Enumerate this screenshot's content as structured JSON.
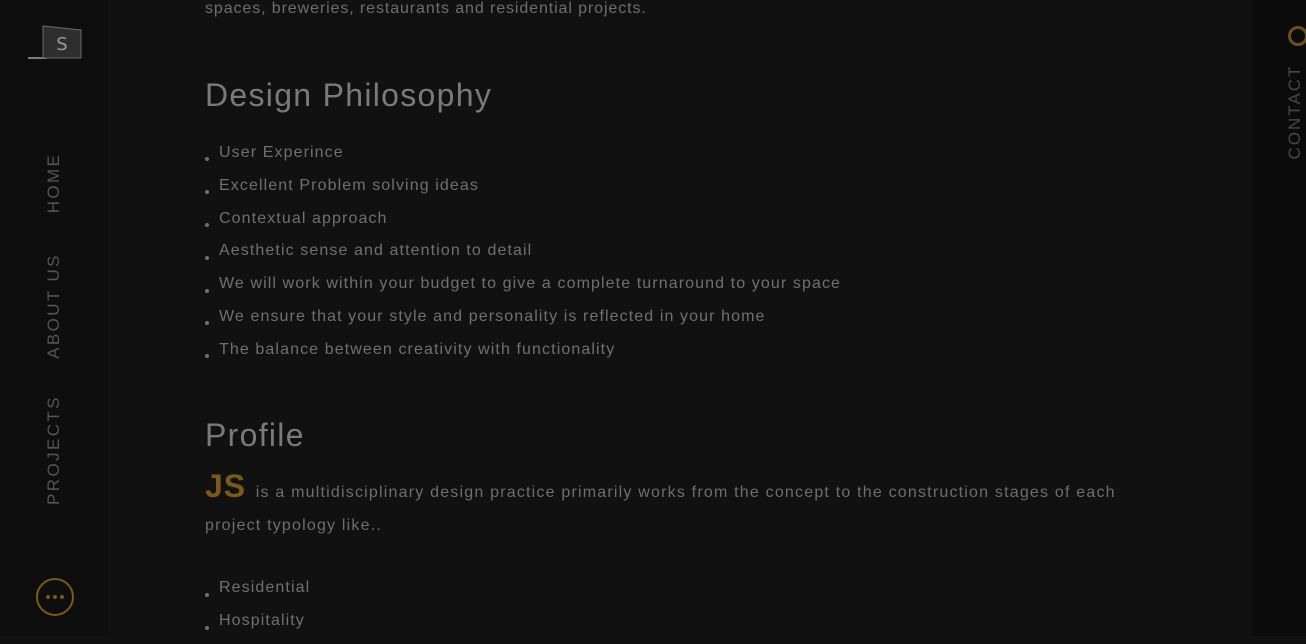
{
  "sidebar": {
    "logo_letter": "S",
    "nav": [
      {
        "label": "HOME"
      },
      {
        "label": "ABOUT US"
      },
      {
        "label": "PROJECTS"
      }
    ]
  },
  "right_bar": {
    "contact_label": "CONTACT"
  },
  "content": {
    "intro_tail": "spaces, breweries, restaurants and residential projects.",
    "philosophy_heading": "Design Philosophy",
    "philosophy_items": [
      "User Experince",
      "Excellent Problem solving ideas",
      "Contextual approach",
      "Aesthetic sense and attention to detail",
      "We will work within your budget to give a complete turnaround to your space",
      "We ensure that your style and personality is reflected in your home",
      "The balance between creativity with functionality"
    ],
    "profile_heading": "Profile",
    "profile_brand": "JS",
    "profile_text": "is a multidisciplinary design practice primarily works from the concept to the construction stages of each project typology like..",
    "categories": [
      "Residential",
      "Hospitality"
    ]
  },
  "colors": {
    "background": "#111111",
    "accent": "#7a5a14"
  }
}
